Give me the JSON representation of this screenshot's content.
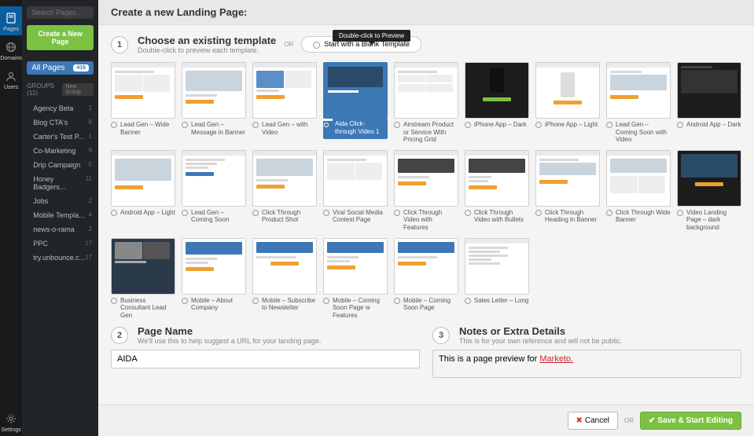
{
  "rail": [
    {
      "label": "Pages",
      "icon": "page"
    },
    {
      "label": "Domains",
      "icon": "globe"
    },
    {
      "label": "Users",
      "icon": "user"
    }
  ],
  "rail_bottom": {
    "label": "Settings",
    "icon": "gear"
  },
  "sidebar": {
    "search_placeholder": "Search Pages...",
    "create_label": "Create a New Page",
    "allpages": {
      "label": "All Pages",
      "count": "416"
    },
    "groups_label": "GROUPS (11)",
    "newgroup_label": "New Group",
    "items": [
      {
        "label": "Agency Beta",
        "n": "2"
      },
      {
        "label": "Blog CTA's",
        "n": "8"
      },
      {
        "label": "Carter's Test P...",
        "n": "1"
      },
      {
        "label": "Co-Marketing",
        "n": "9"
      },
      {
        "label": "Drip Campaign",
        "n": "5"
      },
      {
        "label": "Honey Badgers...",
        "n": "11"
      },
      {
        "label": "Jobs",
        "n": "2"
      },
      {
        "label": "Mobile Templa...",
        "n": "4"
      },
      {
        "label": "news-o-rama",
        "n": "2"
      },
      {
        "label": "PPC",
        "n": "17"
      },
      {
        "label": "try.unbounce.c...",
        "n": "17"
      }
    ]
  },
  "header": "Create a new Landing Page:",
  "step1": {
    "title": "Choose an existing template",
    "sub": "Double-click to preview each template.",
    "or": "OR",
    "blank": "Start with a Blank Template",
    "tooltip": "Double-click to Preview"
  },
  "templates": [
    {
      "name": "Lead Gen – Wide Banner"
    },
    {
      "name": "Lead Gen – Message in Banner"
    },
    {
      "name": "Lead Gen – with Video"
    },
    {
      "name": "Aida Click-through Video 1",
      "selected": true
    },
    {
      "name": "Airstream Product or Service With Pricing Grid"
    },
    {
      "name": "iPhone App – Dark"
    },
    {
      "name": "iPhone App – Light"
    },
    {
      "name": "Lead Gen – Coming Soon with Video"
    },
    {
      "name": "Android App – Dark"
    },
    {
      "name": "Android App – Light"
    },
    {
      "name": "Lead Gen – Coming Soon"
    },
    {
      "name": "Click Through Product Shot"
    },
    {
      "name": "Viral Social Media Contest Page"
    },
    {
      "name": "Click Through Video with Features"
    },
    {
      "name": "Click Through Video with Bullets"
    },
    {
      "name": "Click Through Heading in Banner"
    },
    {
      "name": "Click Through Wide Banner"
    },
    {
      "name": "Video Landing Page – dark background"
    },
    {
      "name": "Business Consultant Lead Gen"
    },
    {
      "name": "Mobile – About Company"
    },
    {
      "name": "Mobile – Subscribe to Newsletter"
    },
    {
      "name": "Mobile – Coming Soon Page w Features"
    },
    {
      "name": "Mobile – Coming Soon Page"
    },
    {
      "name": "Sales Letter – Long"
    }
  ],
  "step2": {
    "title": "Page Name",
    "sub": "We'll use this to help suggest a URL for your landing page.",
    "value": "AIDA"
  },
  "step3": {
    "title": "Notes or Extra Details",
    "sub": "This is for your own reference and will not be public.",
    "value_pre": "This is a page preview for ",
    "value_link": "Marketo."
  },
  "footer": {
    "cancel": "Cancel",
    "or": "OR",
    "save": "Save & Start Editing"
  }
}
